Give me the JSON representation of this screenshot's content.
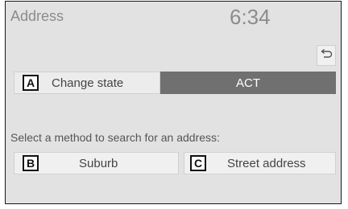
{
  "header": {
    "title": "Address",
    "clock": "6:34"
  },
  "toolbar": {
    "back_icon": "return-arrow-icon"
  },
  "state_row": {
    "change_state_label": "Change state",
    "change_state_badge": "A",
    "state_value": "ACT"
  },
  "search": {
    "prompt": "Select a method to search for an address:",
    "options": [
      {
        "badge": "B",
        "label": "Suburb"
      },
      {
        "badge": "C",
        "label": "Street address"
      }
    ]
  },
  "colors": {
    "screen_background": "#e2e2e2",
    "button_background": "#f0f0f0",
    "selected_state_background": "#707070",
    "header_text": "#8c8c8c"
  }
}
